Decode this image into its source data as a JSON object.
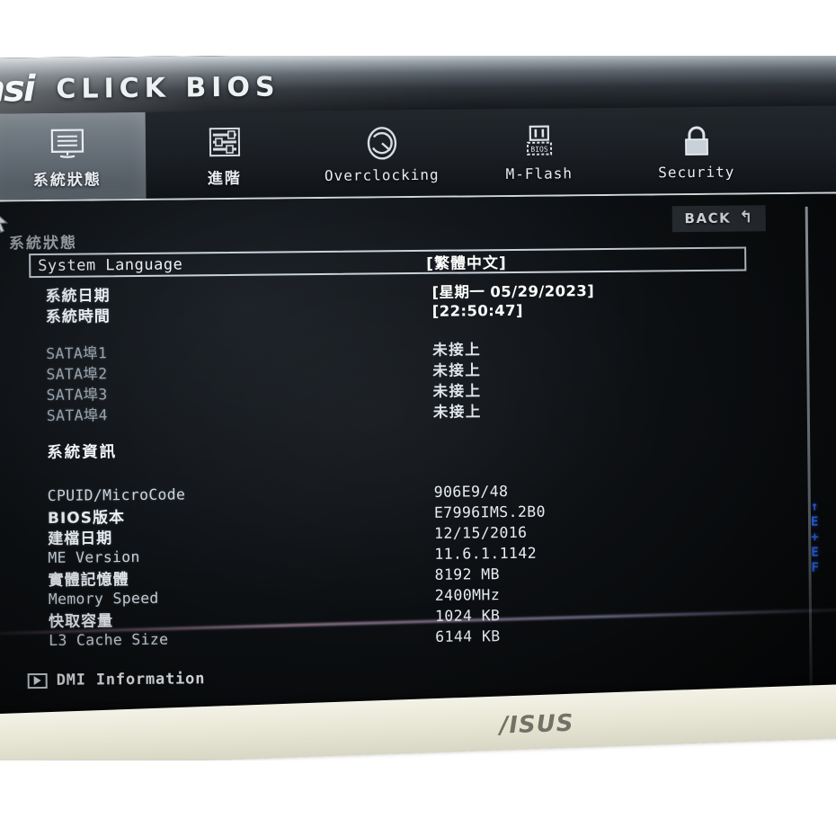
{
  "brand": {
    "logo": "msi",
    "product": "CLICK BIOS"
  },
  "tabs": [
    {
      "label": "系統狀態",
      "icon": "monitor-icon",
      "active": true
    },
    {
      "label": "進階",
      "icon": "sliders-icon",
      "active": false
    },
    {
      "label": "Overclocking",
      "icon": "gauge-icon",
      "active": false
    },
    {
      "label": "M-Flash",
      "icon": "usb-bios-icon",
      "active": false
    },
    {
      "label": "Security",
      "icon": "lock-icon",
      "active": false
    }
  ],
  "header": {
    "breadcrumb": "系統狀態",
    "back_label": "BACK",
    "back_icon": "u-turn-arrow-icon"
  },
  "language_row": {
    "label": "System Language",
    "value": "[繁體中文]"
  },
  "groups": [
    {
      "rows": [
        {
          "key": "系統日期",
          "key_cjk": true,
          "value": "[星期一  05/29/2023]",
          "value_bright": true
        },
        {
          "key": "系統時間",
          "key_cjk": true,
          "value": "[22:50:47]",
          "value_bright": true
        }
      ]
    },
    {
      "rows": [
        {
          "key": "SATA埠1",
          "key_dim": true,
          "value": "未接上",
          "value_cjk": true
        },
        {
          "key": "SATA埠2",
          "key_dim": true,
          "value": "未接上",
          "value_cjk": true
        },
        {
          "key": "SATA埠3",
          "key_dim": true,
          "value": "未接上",
          "value_cjk": true
        },
        {
          "key": "SATA埠4",
          "key_dim": true,
          "value": "未接上",
          "value_cjk": true
        }
      ]
    },
    {
      "title": "系統資訊",
      "rows": [
        {
          "key": "CPUID/MicroCode",
          "value": "906E9/48"
        },
        {
          "key": "BIOS版本",
          "key_cjk": true,
          "value": "E7996IMS.2B0"
        },
        {
          "key": "建檔日期",
          "key_cjk": true,
          "value": "12/15/2016"
        },
        {
          "key": "ME Version",
          "value": "11.6.1.1142"
        },
        {
          "key": "實體記憶體",
          "key_cjk": true,
          "value": "8192 MB"
        },
        {
          "key": "Memory Speed",
          "value": "2400MHz"
        },
        {
          "key": "快取容量",
          "key_cjk": true,
          "value": "1024 KB"
        },
        {
          "key": "L3 Cache Size",
          "value": "6144 KB"
        }
      ]
    }
  ],
  "submenu": {
    "label": "DMI Information",
    "icon": "submenu-arrow-icon"
  },
  "help_panel": {
    "lines": [
      "↑",
      "E",
      "+",
      "E",
      "F"
    ]
  },
  "monitor": {
    "bezel_brand": "/ISUS"
  },
  "colors": {
    "accent_blue": "#2d6cf6",
    "text": "#e7edf3",
    "panel_bg": "#0d1013"
  }
}
